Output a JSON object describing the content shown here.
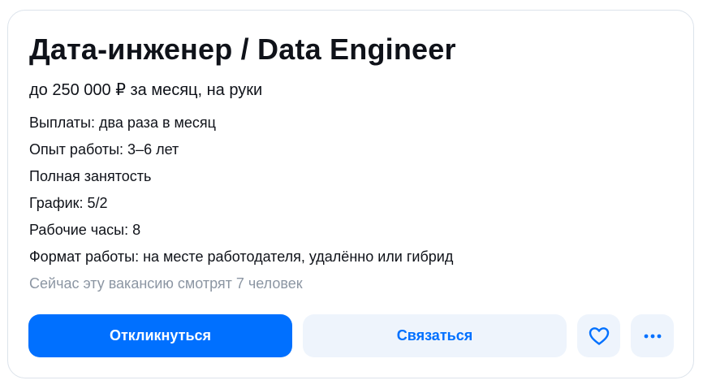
{
  "vacancy": {
    "title": "Дата-инженер / Data Engineer",
    "salary": "до 250 000 ₽ за месяц, на руки",
    "details": [
      "Выплаты: два раза в месяц",
      "Опыт работы: 3–6 лет",
      "Полная занятость",
      "График: 5/2",
      "Рабочие часы: 8",
      "Формат работы: на месте работодателя, удалённо или гибрид"
    ],
    "viewers": "Сейчас эту вакансию смотрят 7 человек"
  },
  "actions": {
    "apply_label": "Откликнуться",
    "contact_label": "Связаться",
    "favorite_icon": "heart-icon",
    "more_icon": "more-horizontal-icon"
  },
  "colors": {
    "accent": "#0070ff",
    "secondary_bg": "#eef4fc",
    "muted_text": "#8c96a3",
    "border": "#dce3eb"
  }
}
